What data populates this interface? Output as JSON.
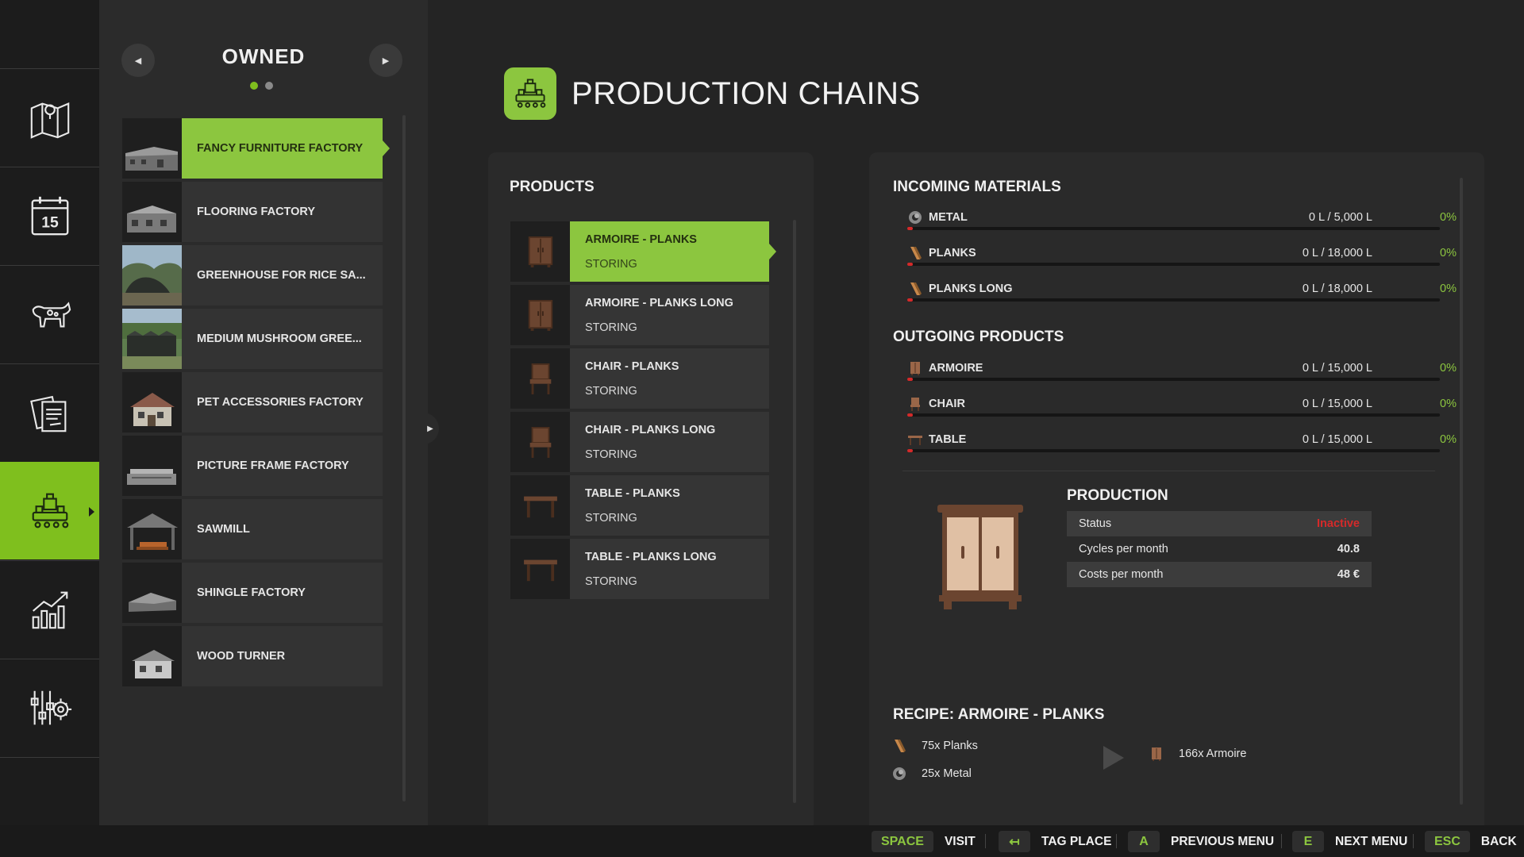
{
  "owned": {
    "title": "OWNED",
    "page_dots": 2,
    "active_page": 1,
    "items": [
      {
        "label": "FANCY FURNITURE FACTORY",
        "active": true
      },
      {
        "label": "FLOORING FACTORY"
      },
      {
        "label": "GREENHOUSE FOR RICE SA..."
      },
      {
        "label": "MEDIUM MUSHROOM GREE..."
      },
      {
        "label": "PET ACCESSORIES FACTORY"
      },
      {
        "label": "PICTURE FRAME FACTORY"
      },
      {
        "label": "SAWMILL"
      },
      {
        "label": "SHINGLE FACTORY"
      },
      {
        "label": "WOOD TURNER"
      }
    ]
  },
  "rail": {
    "items": [
      {
        "icon": "map-icon"
      },
      {
        "icon": "calendar-icon",
        "text": "15"
      },
      {
        "icon": "cow-icon"
      },
      {
        "icon": "contracts-icon"
      },
      {
        "icon": "production-icon",
        "active": true
      },
      {
        "icon": "statistics-icon"
      },
      {
        "icon": "settings-icon"
      }
    ]
  },
  "page": {
    "title": "PRODUCTION CHAINS"
  },
  "products": {
    "title": "PRODUCTS",
    "items": [
      {
        "name": "ARMOIRE - PLANKS",
        "status": "STORING",
        "icon": "armoire",
        "active": true
      },
      {
        "name": "ARMOIRE - PLANKS LONG",
        "status": "STORING",
        "icon": "armoire"
      },
      {
        "name": "CHAIR - PLANKS",
        "status": "STORING",
        "icon": "chair"
      },
      {
        "name": "CHAIR - PLANKS LONG",
        "status": "STORING",
        "icon": "chair"
      },
      {
        "name": "TABLE - PLANKS",
        "status": "STORING",
        "icon": "table"
      },
      {
        "name": "TABLE - PLANKS LONG",
        "status": "STORING",
        "icon": "table"
      }
    ]
  },
  "incoming": {
    "title": "INCOMING MATERIALS",
    "items": [
      {
        "name": "METAL",
        "value": "0 L / 5,000 L",
        "pct": "0%",
        "icon": "metal-icon"
      },
      {
        "name": "PLANKS",
        "value": "0 L / 18,000 L",
        "pct": "0%",
        "icon": "planks-icon"
      },
      {
        "name": "PLANKS LONG",
        "value": "0 L / 18,000 L",
        "pct": "0%",
        "icon": "planks-icon"
      }
    ]
  },
  "outgoing": {
    "title": "OUTGOING PRODUCTS",
    "items": [
      {
        "name": "ARMOIRE",
        "value": "0 L / 15,000 L",
        "pct": "0%",
        "icon": "armoire-icon"
      },
      {
        "name": "CHAIR",
        "value": "0 L / 15,000 L",
        "pct": "0%",
        "icon": "chair-icon"
      },
      {
        "name": "TABLE",
        "value": "0 L / 15,000 L",
        "pct": "0%",
        "icon": "table-icon"
      }
    ]
  },
  "production": {
    "title": "PRODUCTION",
    "rows": [
      {
        "label": "Status",
        "value": "Inactive"
      },
      {
        "label": "Cycles per month",
        "value": "40.8"
      },
      {
        "label": "Costs per month",
        "value": "48 €"
      }
    ]
  },
  "recipe": {
    "title": "RECIPE: ARMOIRE - PLANKS",
    "inputs": [
      {
        "text": "75x Planks",
        "icon": "planks-icon"
      },
      {
        "text": "25x Metal",
        "icon": "metal-icon"
      }
    ],
    "output": {
      "text": "166x Armoire",
      "icon": "armoire-icon"
    }
  },
  "hints": [
    {
      "key": "SPACE",
      "label": "VISIT"
    },
    {
      "key": "↤",
      "label": "TAG PLACE"
    },
    {
      "key": "A",
      "label": "PREVIOUS MENU"
    },
    {
      "key": "E",
      "label": "NEXT MENU"
    },
    {
      "key": "ESC",
      "label": "BACK"
    }
  ],
  "colors": {
    "accent": "#8cc63f",
    "inactive": "#d42a2a",
    "wood": "#8a5a3a"
  }
}
